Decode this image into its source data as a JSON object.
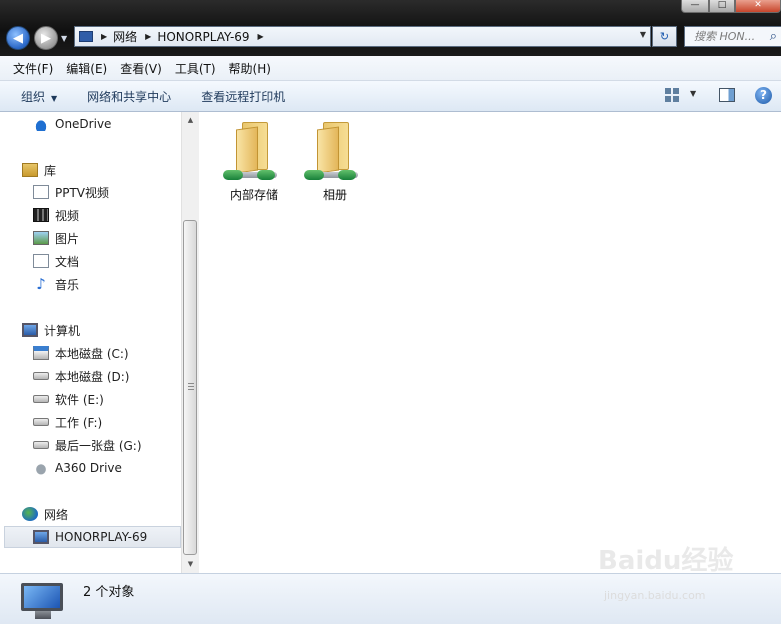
{
  "window": {
    "controls": {
      "minimize": "—",
      "maximize": "□",
      "close": "✕"
    }
  },
  "navigation": {
    "back_icon": "arrow-left-icon",
    "forward_icon": "arrow-right-icon",
    "address": {
      "breadcrumbs": [
        "网络",
        "HONORPLAY-69"
      ]
    },
    "search_placeholder": "搜索 HON...",
    "refresh_symbol": "↻"
  },
  "menubar": {
    "items": [
      "文件(F)",
      "编辑(E)",
      "查看(V)",
      "工具(T)",
      "帮助(H)"
    ]
  },
  "toolbar": {
    "organize": "组织",
    "network_center": "网络和共享中心",
    "remote_printer": "查看远程打印机",
    "help_symbol": "?"
  },
  "sidebar": {
    "onedrive": "OneDrive",
    "library": {
      "label": "库",
      "items": [
        "PPTV视频",
        "视频",
        "图片",
        "文档",
        "音乐"
      ]
    },
    "computer": {
      "label": "计算机",
      "items": [
        "本地磁盘 (C:)",
        "本地磁盘 (D:)",
        "软件 (E:)",
        "工作 (F:)",
        "最后一张盘 (G:)",
        "A360 Drive"
      ]
    },
    "network": {
      "label": "网络",
      "items": [
        "HONORPLAY-69"
      ],
      "selected": "HONORPLAY-69"
    }
  },
  "content": {
    "items": [
      {
        "name": "内部存储",
        "icon": "shared-folder-icon"
      },
      {
        "name": "相册",
        "icon": "shared-folder-icon"
      }
    ]
  },
  "statusbar": {
    "text": "2 个对象"
  },
  "watermark": {
    "text": "Baidu经验",
    "url": "jingyan.baidu.com"
  }
}
